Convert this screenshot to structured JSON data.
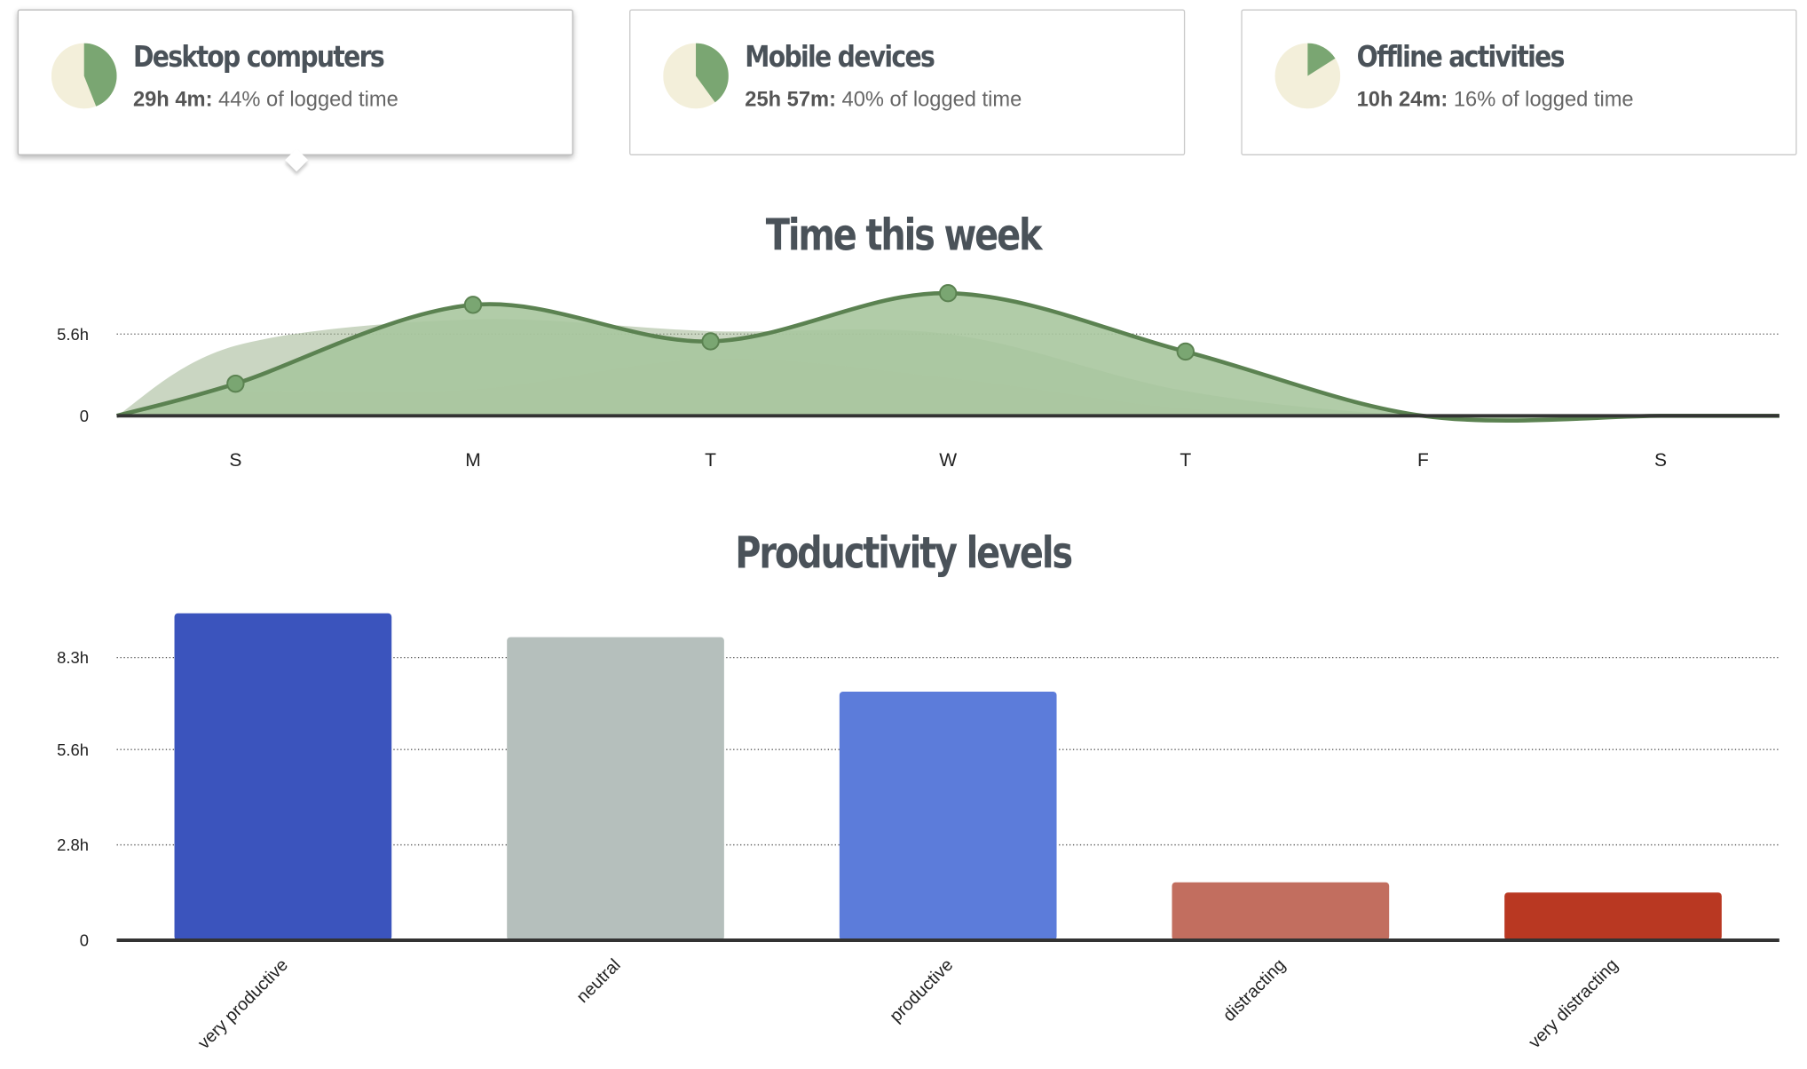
{
  "cards": [
    {
      "title": "Desktop computers",
      "duration": "29h 4m:",
      "share_text": "44% of logged time",
      "fraction": 0.44,
      "active": true
    },
    {
      "title": "Mobile devices",
      "duration": "25h 57m:",
      "share_text": "40% of logged time",
      "fraction": 0.4,
      "active": false
    },
    {
      "title": "Offline activities",
      "duration": "10h 24m:",
      "share_text": "16% of logged time",
      "fraction": 0.16,
      "active": false
    }
  ],
  "colors": {
    "pie_bg": "#f3efda",
    "pie_fill": "#7aa672",
    "line": "#5b8251",
    "area_main": "#a8c69e",
    "area_mid": "#9fb590",
    "area_back": "#ebe5dc",
    "axis": "#333333",
    "grid": "#555555"
  },
  "chart_data": [
    {
      "type": "area",
      "title": "Time this week",
      "categories": [
        "S",
        "M",
        "T",
        "W",
        "T",
        "F",
        "S"
      ],
      "y_ticks": [
        "0",
        "5.6h"
      ],
      "y_tick_values": [
        0,
        5.6
      ],
      "ylim": [
        0,
        7.5
      ],
      "series": [
        {
          "values": [
            2.2,
            7.6,
            5.1,
            8.4,
            4.4,
            0,
            0
          ]
        },
        {
          "values": [
            4.8,
            6.6,
            5.8,
            5.6,
            1.7,
            0,
            0
          ]
        },
        {
          "values": [
            1.6,
            1.8,
            3.9,
            2.6,
            0.5,
            0,
            0
          ]
        }
      ]
    },
    {
      "type": "bar",
      "title": "Productivity levels",
      "categories": [
        "very productive",
        "neutral",
        "productive",
        "distracting",
        "very distracting"
      ],
      "values": [
        9.6,
        8.9,
        7.3,
        1.7,
        1.4
      ],
      "colors": [
        "#3b54bd",
        "#b5bfbc",
        "#5c7cda",
        "#c26e5f",
        "#b93822"
      ],
      "y_ticks": [
        "0",
        "2.8h",
        "5.6h",
        "8.3h"
      ],
      "y_tick_values": [
        0,
        2.8,
        5.6,
        8.3
      ],
      "ylim": [
        0,
        10
      ]
    }
  ]
}
